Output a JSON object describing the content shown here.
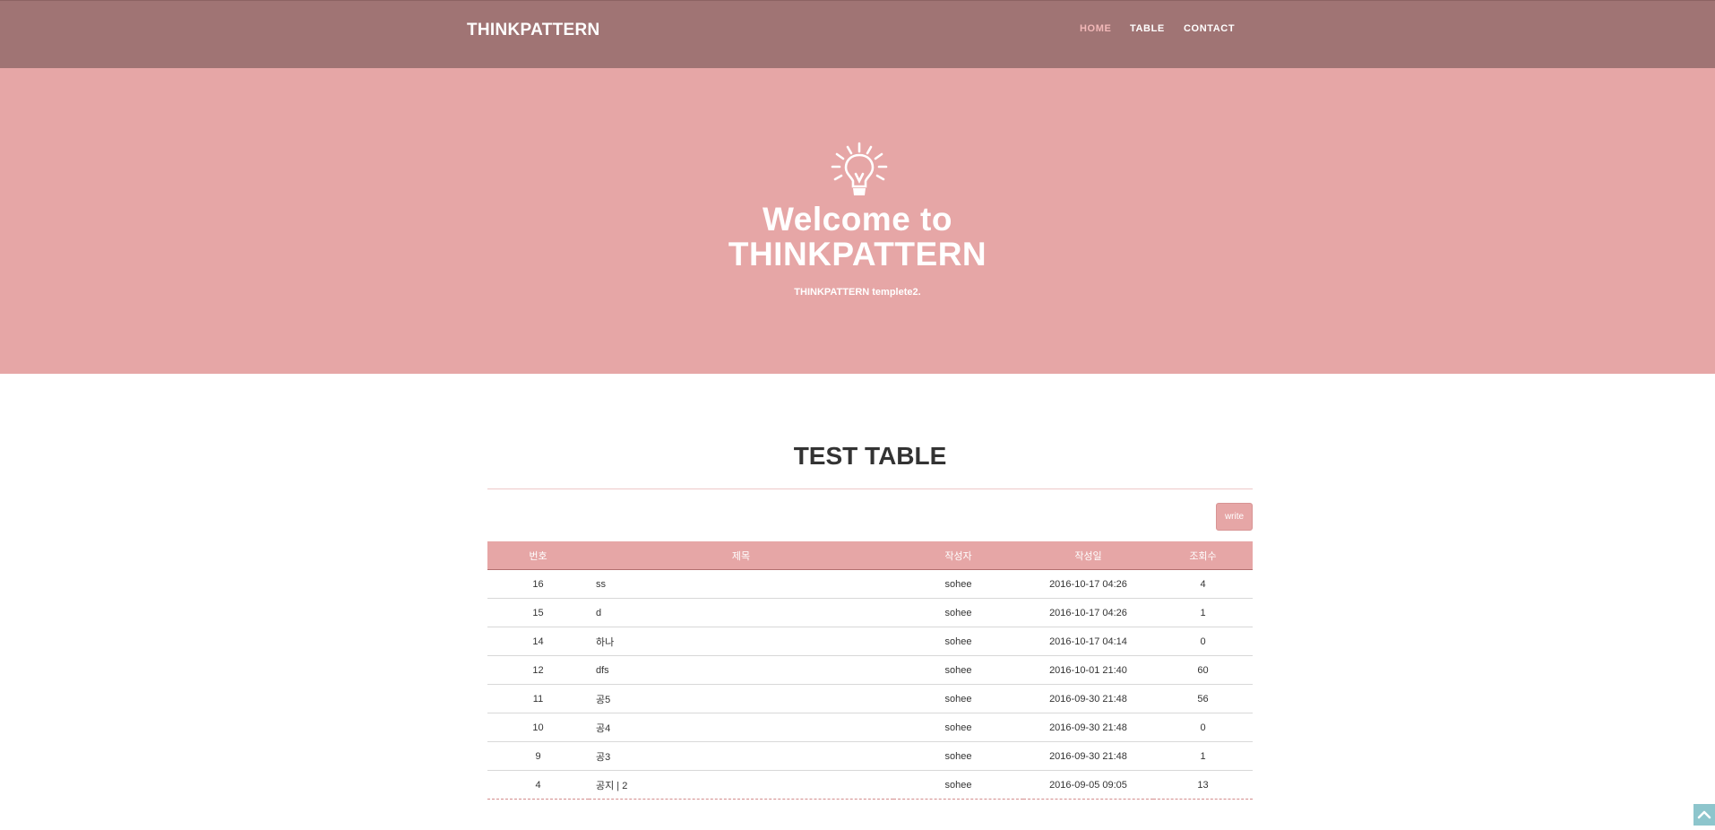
{
  "nav": {
    "brand": "THINKPATTERN",
    "links": [
      {
        "label": "HOME",
        "active": true
      },
      {
        "label": "TABLE",
        "active": false
      },
      {
        "label": "CONTACT",
        "active": false
      }
    ]
  },
  "hero": {
    "icon": "lightbulb-icon",
    "title_line1": "Welcome to",
    "title_line2": "THINKPATTERN",
    "subtitle": "THINKPATTERN templete2."
  },
  "section": {
    "title": "TEST TABLE",
    "write_label": "write"
  },
  "table": {
    "headers": [
      "번호",
      "제목",
      "작성자",
      "작성일",
      "조회수"
    ],
    "rows": [
      [
        "16",
        "ss",
        "sohee",
        "2016-10-17 04:26",
        "4"
      ],
      [
        "15",
        "d",
        "sohee",
        "2016-10-17 04:26",
        "1"
      ],
      [
        "14",
        "하나",
        "sohee",
        "2016-10-17 04:14",
        "0"
      ],
      [
        "12",
        "dfs",
        "sohee",
        "2016-10-01 21:40",
        "60"
      ],
      [
        "11",
        "공5",
        "sohee",
        "2016-09-30 21:48",
        "56"
      ],
      [
        "10",
        "공4",
        "sohee",
        "2016-09-30 21:48",
        "0"
      ],
      [
        "9",
        "공3",
        "sohee",
        "2016-09-30 21:48",
        "1"
      ],
      [
        "4",
        "공지 | 2",
        "sohee",
        "2016-09-05 09:05",
        "13"
      ]
    ]
  },
  "scroll_top": {
    "icon": "chevron-up-icon"
  },
  "colors": {
    "navbar": "#a07474",
    "hero": "#e6a6a6",
    "accent": "#e6a6a6",
    "active_link": "#f2b8b8",
    "scroll_top": "#8dc5cc"
  }
}
